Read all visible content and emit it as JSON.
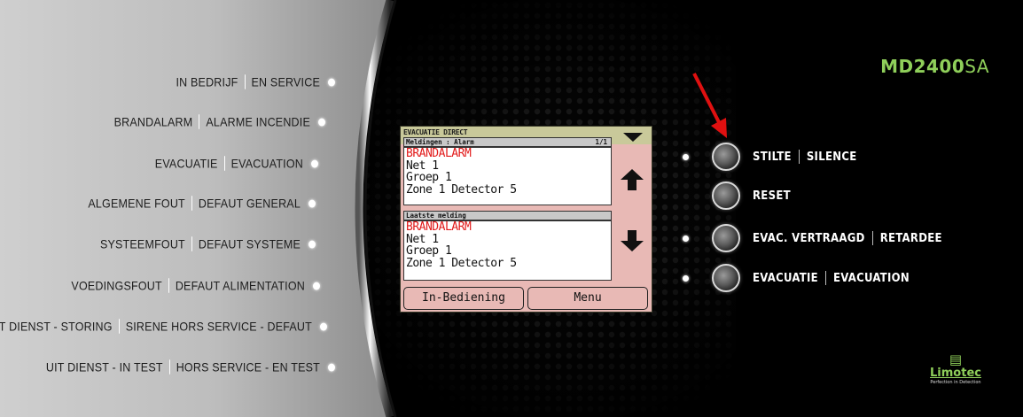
{
  "brand": {
    "model_bold": "MD2400",
    "model_suffix": "SA",
    "logo_name": "Limotec",
    "logo_tagline": "Perfection in Detection"
  },
  "leds": [
    {
      "nl": "IN BEDRIJF",
      "fr": "EN SERVICE"
    },
    {
      "nl": "BRANDALARM",
      "fr": "ALARME INCENDIE"
    },
    {
      "nl": "EVACUATIE",
      "fr": "EVACUATION"
    },
    {
      "nl": "ALGEMENE FOUT",
      "fr": "DEFAUT GENERAL"
    },
    {
      "nl": "SYSTEEMFOUT",
      "fr": "DEFAUT SYSTEME"
    },
    {
      "nl": "VOEDINGSFOUT",
      "fr": "DEFAUT ALIMENTATION"
    },
    {
      "nl": "SIRENE UIT DIENST - STORING",
      "fr": "SIRENE HORS SERVICE - DEFAUT"
    },
    {
      "nl": "UIT DIENST - IN TEST",
      "fr": "HORS SERVICE - EN TEST"
    }
  ],
  "lcd": {
    "title": "EVACUATIE DIRECT",
    "section1": {
      "header": "Meldingen : Alarm",
      "page": "1/1",
      "lines": [
        "BRANDALARM",
        "Net 1",
        "Groep 1",
        "Zone 1 Detector 5"
      ]
    },
    "section2": {
      "header": "Laatste melding",
      "lines": [
        "BRANDALARM",
        "Net 1",
        "Groep 1",
        "Zone 1 Detector 5"
      ]
    },
    "buttons": {
      "left": "In-Bediening",
      "right": "Menu"
    }
  },
  "controls": [
    {
      "nl": "STILTE",
      "fr": "SILENCE",
      "led": true
    },
    {
      "nl": "RESET",
      "fr": "",
      "led": false
    },
    {
      "nl": "EVAC. VERTRAAGD",
      "fr": "RETARDEE",
      "led": true
    },
    {
      "nl": "EVACUATIE",
      "fr": "EVACUATION",
      "led": true
    }
  ],
  "colors": {
    "accent_green": "#8fcf5a",
    "alarm_red": "#e21a1a",
    "lcd_bg": "#e8b9b5",
    "pointer_red": "#e01010"
  }
}
